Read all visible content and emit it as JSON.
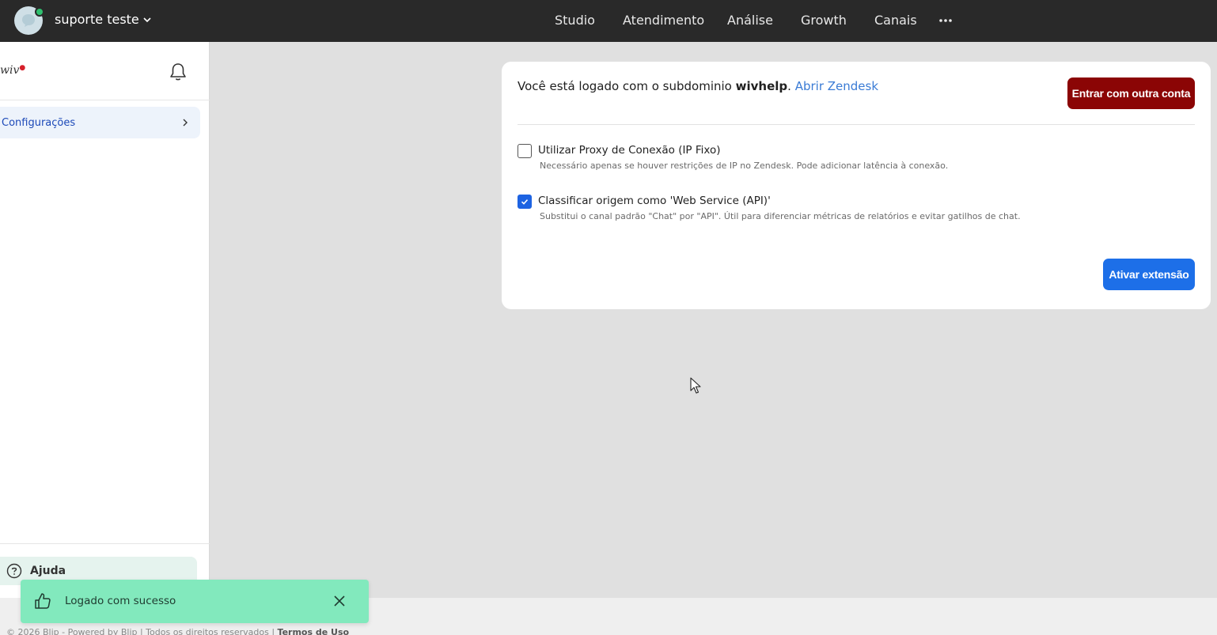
{
  "topbar": {
    "account_name": "suporte teste",
    "nav": [
      "Studio",
      "Atendimento",
      "Análise",
      "Growth",
      "Canais"
    ],
    "more_icon": "more-horizontal-icon"
  },
  "sidebar": {
    "logo": "wiv",
    "items": [
      {
        "label": "Configurações",
        "icon": "chevron-right-icon"
      }
    ],
    "help_label": "Ajuda"
  },
  "card": {
    "login_prefix": "Você está logado com o subdominio ",
    "subdomain": "wivhelp",
    "login_dot": ".",
    "open_link": "Abrir Zendesk",
    "other_account_button": "Entrar com outra conta",
    "options": [
      {
        "label": "Utilizar Proxy de Conexão (IP Fixo)",
        "description": "Necessário apenas se houver restrições de IP no Zendesk. Pode adicionar latência à conexão.",
        "checked": false
      },
      {
        "label": "Classificar origem como 'Web Service (API)'",
        "description": "Substitui o canal padrão \"Chat\" por \"API\". Útil para diferenciar métricas de relatórios e evitar gatilhos de chat.",
        "checked": true
      }
    ],
    "activate_button": "Ativar extensão"
  },
  "toast": {
    "message": "Logado com sucesso",
    "icon": "thumbs-up-icon"
  },
  "footer": {
    "text": "© 2026 Blip - Powered by Blip | Todos os direitos reservados | ",
    "terms": "Termos de Uso"
  },
  "colors": {
    "topbar": "#292929",
    "primary_button": "#1d6fe8",
    "danger_button": "#8b0505",
    "toast": "#82e9bd",
    "link": "#3a7bd5"
  }
}
